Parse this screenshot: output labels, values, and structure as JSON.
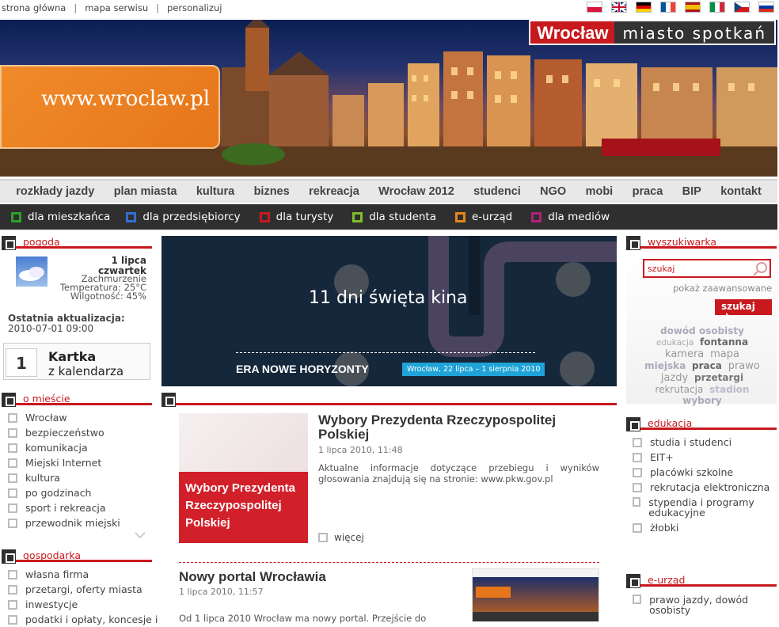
{
  "topnav": {
    "links": [
      "strona główna",
      "mapa serwisu",
      "personalizuj"
    ],
    "sep": "|"
  },
  "languages": [
    {
      "name": "pl-flag",
      "colors": [
        "#ffffff",
        "#dc143c"
      ]
    },
    {
      "name": "en-flag",
      "colors": [
        "#012169",
        "#c8102e"
      ]
    },
    {
      "name": "de-flag",
      "colors": [
        "#000000",
        "#dd0000",
        "#ffce00"
      ]
    },
    {
      "name": "fr-flag",
      "colors": [
        "#0055a4",
        "#ffffff",
        "#ef4135"
      ]
    },
    {
      "name": "es-flag",
      "colors": [
        "#aa151b",
        "#f1bf00",
        "#aa151b"
      ]
    },
    {
      "name": "it-flag",
      "colors": [
        "#009246",
        "#ffffff",
        "#ce2b37"
      ]
    },
    {
      "name": "cz-flag",
      "colors": [
        "#ffffff",
        "#11457e",
        "#d7141a"
      ]
    },
    {
      "name": "ru-flag",
      "colors": [
        "#ffffff",
        "#0039a6",
        "#d52b1e"
      ]
    }
  ],
  "banner": {
    "site": "www.wroclaw.pl",
    "city": "Wrocław",
    "motto": "miasto spotkań"
  },
  "mainnav": [
    "rozkłady jazdy",
    "plan miasta",
    "kultura",
    "biznes",
    "rekreacja",
    "Wrocław 2012",
    "studenci",
    "NGO",
    "mobi",
    "praca",
    "BIP",
    "kontakt"
  ],
  "subnav": [
    {
      "label": "dla mieszkańca",
      "color": "#2e9e2e"
    },
    {
      "label": "dla przedsiębiorcy",
      "color": "#2f6fd2"
    },
    {
      "label": "dla turysty",
      "color": "#c8191f"
    },
    {
      "label": "dla studenta",
      "color": "#7fbf2a"
    },
    {
      "label": "e-urząd",
      "color": "#e6861a"
    },
    {
      "label": "dla mediów",
      "color": "#b0207a"
    }
  ],
  "weather": {
    "header": "pogoda",
    "date1": "1 lipca",
    "date2": "czwartek",
    "cond": "Zachmurzenie",
    "temp": "Temperatura: 25°C",
    "hum": "Wilgotność: 45%",
    "upd_label": "Ostatnia aktualizacja:",
    "upd_value": "2010-07-01 09:00"
  },
  "calendar": {
    "day": "1",
    "line1": "Kartka",
    "line2": "z kalendarza"
  },
  "omiescie": {
    "header": "o mieście",
    "items": [
      "Wrocław",
      "bezpieczeństwo",
      "komunikacja",
      "Miejski Internet",
      "kultura",
      "po godzinach",
      "sport i rekreacja",
      "przewodnik miejski"
    ]
  },
  "gospodarka": {
    "header": "gospodarka",
    "items": [
      "własna firma",
      "przetargi, oferty miasta",
      "inwestycje",
      "podatki i opłaty, koncesje i"
    ]
  },
  "hero": {
    "title": "11 dni święta kina",
    "brand": "ERA NOWE HORYZONTY",
    "dates": "Wrocław, 22 lipca – 1 sierpnia 2010"
  },
  "news": [
    {
      "title": "Wybory Prezydenta Rzeczypospolitej Polskiej",
      "date": "1 lipca 2010, 11:48",
      "text": "Aktualne informacje dotyczące przebiegu i wyników głosowania znajdują się na stronie: www.pkw.gov.pl",
      "image_caption": "Wybory Prezydenta Rzeczypospolitej Polskiej",
      "more": "więcej"
    },
    {
      "title": "Nowy portal Wrocławia",
      "date": "1 lipca 2010, 11:57",
      "text": "Od 1 lipca 2010 Wrocław ma nowy portal. Przejście do"
    }
  ],
  "search": {
    "header": "wyszukiwarka",
    "placeholder": "szukaj",
    "advanced": "pokaż zaawansowane",
    "button": "szukaj"
  },
  "tags": [
    "dowód osobisty",
    "edukacja",
    "fontanna",
    "kamera",
    "mapa",
    "miejska",
    "praca",
    "prawo",
    "jazdy",
    "przetargi",
    "rekrutacja",
    "stadion",
    "wybory"
  ],
  "edukacja": {
    "header": "edukacja",
    "items": [
      "studia i studenci",
      "EIT+",
      "placówki szkolne",
      "rekrutacja elektroniczna",
      "stypendia i programy edukacyjne",
      "żłobki"
    ]
  },
  "eurzad": {
    "header": "e-urząd",
    "items": [
      "prawo jazdy, dowód osobisty"
    ]
  }
}
